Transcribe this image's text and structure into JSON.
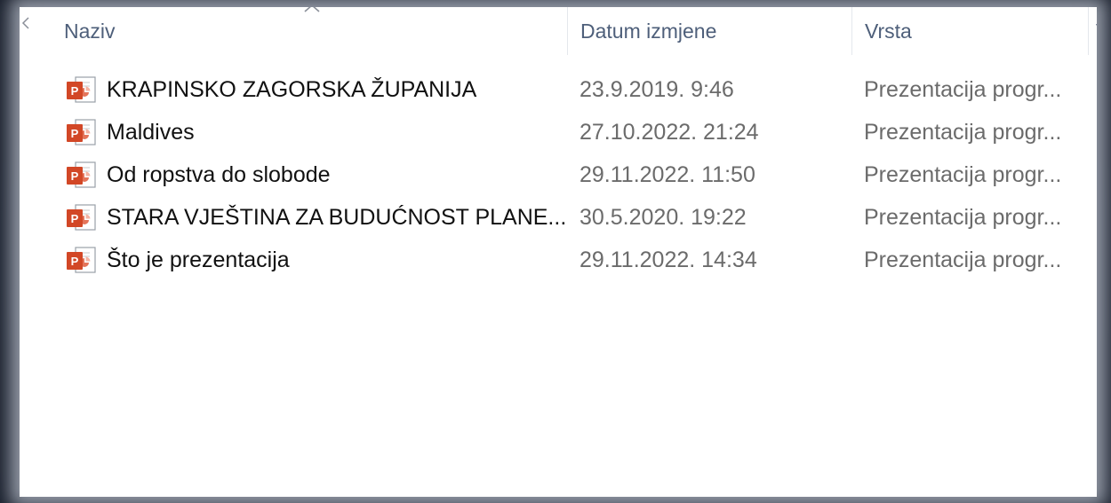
{
  "columns": {
    "name": "Naziv",
    "date": "Datum izmjene",
    "type": "Vrsta",
    "more": "V"
  },
  "files": [
    {
      "name": "KRAPINSKO ZAGORSKA ŽUPANIJA",
      "date": "23.9.2019. 9:46",
      "type": "Prezentacija progr...",
      "icon": "powerpoint-file-icon"
    },
    {
      "name": "Maldives",
      "date": "27.10.2022. 21:24",
      "type": "Prezentacija progr...",
      "icon": "powerpoint-file-icon"
    },
    {
      "name": "Od ropstva do slobode",
      "date": "29.11.2022. 11:50",
      "type": "Prezentacija progr...",
      "icon": "powerpoint-file-icon"
    },
    {
      "name": "STARA VJEŠTINA ZA BUDUĆNOST PLANE...",
      "date": "30.5.2020. 19:22",
      "type": "Prezentacija progr...",
      "icon": "powerpoint-file-icon"
    },
    {
      "name": "Što je prezentacija",
      "date": "29.11.2022. 14:34",
      "type": "Prezentacija progr...",
      "icon": "powerpoint-file-icon"
    }
  ],
  "colors": {
    "header_text": "#4e5f7a",
    "name_text": "#111111",
    "meta_text": "#6b6b6b",
    "ppt_orange": "#d24726"
  }
}
